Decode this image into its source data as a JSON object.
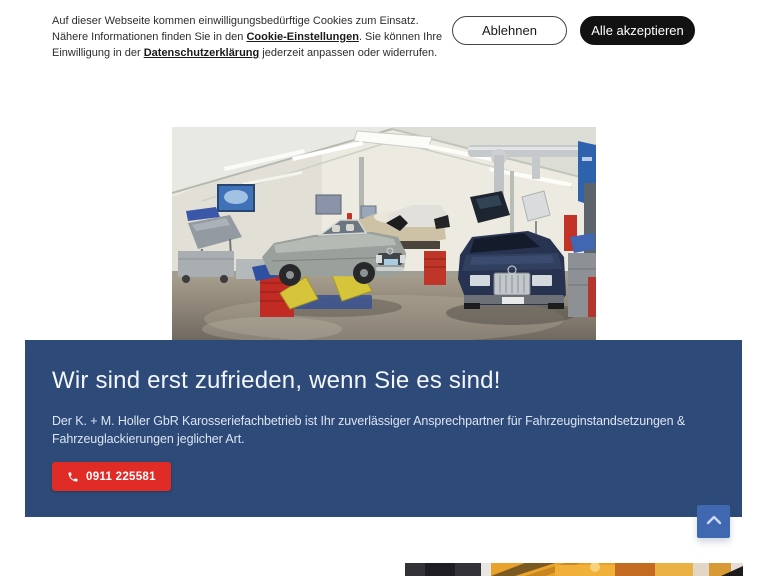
{
  "cookie_banner": {
    "message_part1": "Auf dieser Webseite kommen einwilligungsbedürftige Cookies zum Einsatz. Nähere Informationen finden Sie in den ",
    "cookie_settings_link": "Cookie-Einstellungen",
    "message_part2": ". Sie können Ihre Einwilligung in der ",
    "privacy_link": "Datenschutzerklärung",
    "message_part3": " jederzeit anpassen oder widerrufen.",
    "decline_button": "Ablehnen",
    "accept_button": "Alle akzeptieren"
  },
  "hero": {
    "image_description": "Werkstatthalle mit klassischen Mercedes-Fahrzeugen, Hebebühnen und Werkzeugwagen"
  },
  "cta_banner": {
    "heading": "Wir sind erst zufrieden, wenn Sie es sind!",
    "description": "Der K. + M. Holler GbR Karosseriefachbetrieb ist Ihr zuverlässiger Ansprechpartner für Fahrzeuginstandsetzungen & Fahrzeuglackierungen jeglicher Art.",
    "phone_number": "0911 225581"
  },
  "colors": {
    "banner_blue": "#2d4a78",
    "phone_button_red": "#e02b27",
    "scroll_button_blue": "#4068b0",
    "accept_button_black": "#121212"
  }
}
